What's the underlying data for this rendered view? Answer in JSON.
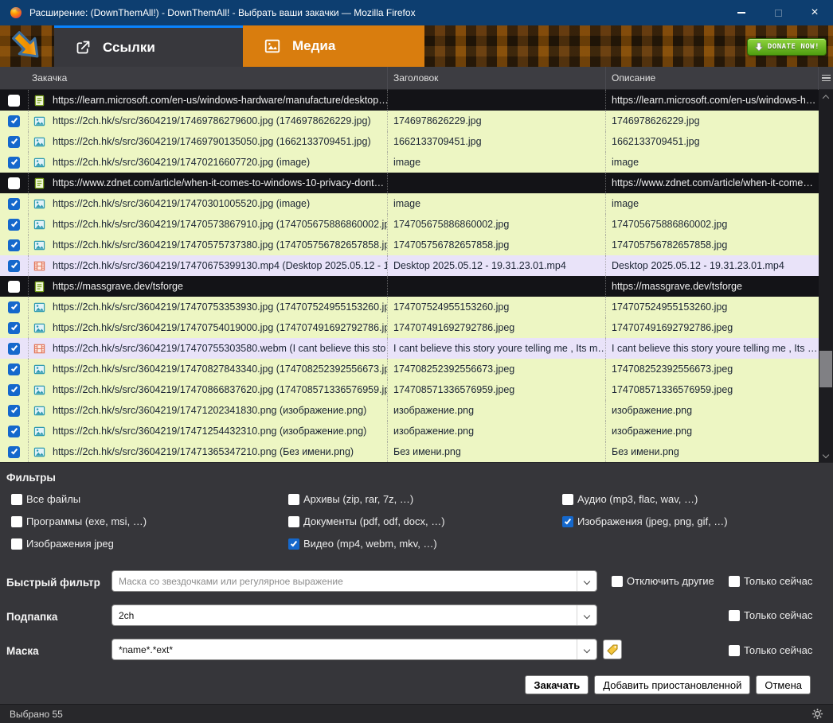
{
  "window": {
    "title": "Расширение: (DownThemAll!) - DownThemAll! - Выбрать ваши закачки — Mozilla Firefox"
  },
  "tabs": {
    "links": "Ссылки",
    "media": "Медиа"
  },
  "donate_label": "DONATE NOW!",
  "table": {
    "columns": [
      "Закачка",
      "Заголовок",
      "Описание"
    ],
    "rows": [
      {
        "checked": false,
        "variant": "dark",
        "icon": "doc",
        "url": "https://learn.microsoft.com/en-us/windows-hardware/manufacture/desktop…",
        "title": "",
        "desc": "https://learn.microsoft.com/en-us/windows-h…"
      },
      {
        "checked": true,
        "variant": "green",
        "icon": "image",
        "url": "https://2ch.hk/s/src/3604219/17469786279600.jpg (1746978626229.jpg)",
        "title": "1746978626229.jpg",
        "desc": "1746978626229.jpg"
      },
      {
        "checked": true,
        "variant": "green",
        "icon": "image",
        "url": "https://2ch.hk/s/src/3604219/17469790135050.jpg (1662133709451.jpg)",
        "title": "1662133709451.jpg",
        "desc": "1662133709451.jpg"
      },
      {
        "checked": true,
        "variant": "green",
        "icon": "image",
        "url": "https://2ch.hk/s/src/3604219/17470216607720.jpg (image)",
        "title": "image",
        "desc": "image"
      },
      {
        "checked": false,
        "variant": "dark",
        "icon": "doc",
        "url": "https://www.zdnet.com/article/when-it-comes-to-windows-10-privacy-dont…",
        "title": "",
        "desc": "https://www.zdnet.com/article/when-it-come…"
      },
      {
        "checked": true,
        "variant": "green",
        "icon": "image",
        "url": "https://2ch.hk/s/src/3604219/17470301005520.jpg (image)",
        "title": "image",
        "desc": "image"
      },
      {
        "checked": true,
        "variant": "green",
        "icon": "image",
        "url": "https://2ch.hk/s/src/3604219/17470573867910.jpg (174705675886860002.jp…",
        "title": "174705675886860002.jpg",
        "desc": "174705675886860002.jpg"
      },
      {
        "checked": true,
        "variant": "green",
        "icon": "image",
        "url": "https://2ch.hk/s/src/3604219/17470575737380.jpg (174705756782657858.jp…",
        "title": "174705756782657858.jpg",
        "desc": "174705756782657858.jpg"
      },
      {
        "checked": true,
        "variant": "lavender",
        "icon": "video",
        "url": "https://2ch.hk/s/src/3604219/17470675399130.mp4 (Desktop 2025.05.12 - 1…",
        "title": "Desktop 2025.05.12 - 19.31.23.01.mp4",
        "desc": "Desktop 2025.05.12 - 19.31.23.01.mp4"
      },
      {
        "checked": false,
        "variant": "dark",
        "icon": "doc",
        "url": "https://massgrave.dev/tsforge",
        "title": "",
        "desc": "https://massgrave.dev/tsforge"
      },
      {
        "checked": true,
        "variant": "green",
        "icon": "image",
        "url": "https://2ch.hk/s/src/3604219/17470753353930.jpg (174707524955153260.jp…",
        "title": "174707524955153260.jpg",
        "desc": "174707524955153260.jpg"
      },
      {
        "checked": true,
        "variant": "green",
        "icon": "image",
        "url": "https://2ch.hk/s/src/3604219/17470754019000.jpg (174707491692792786.jp…",
        "title": "174707491692792786.jpeg",
        "desc": "174707491692792786.jpeg"
      },
      {
        "checked": true,
        "variant": "lavender",
        "icon": "video",
        "url": "https://2ch.hk/s/src/3604219/17470755303580.webm (I cant believe this sto…",
        "title": "I cant believe this story youre telling me , Its m…",
        "desc": "I cant believe this story youre telling me , Its …"
      },
      {
        "checked": true,
        "variant": "green",
        "icon": "image",
        "url": "https://2ch.hk/s/src/3604219/17470827843340.jpg (174708252392556673.jp…",
        "title": "174708252392556673.jpeg",
        "desc": "174708252392556673.jpeg"
      },
      {
        "checked": true,
        "variant": "green",
        "icon": "image",
        "url": "https://2ch.hk/s/src/3604219/17470866837620.jpg (174708571336576959.jp…",
        "title": "174708571336576959.jpeg",
        "desc": "174708571336576959.jpeg"
      },
      {
        "checked": true,
        "variant": "green",
        "icon": "image",
        "url": "https://2ch.hk/s/src/3604219/17471202341830.png (изображение.png)",
        "title": "изображение.png",
        "desc": "изображение.png"
      },
      {
        "checked": true,
        "variant": "green",
        "icon": "image",
        "url": "https://2ch.hk/s/src/3604219/17471254432310.png (изображение.png)",
        "title": "изображение.png",
        "desc": "изображение.png"
      },
      {
        "checked": true,
        "variant": "green",
        "icon": "image",
        "url": "https://2ch.hk/s/src/3604219/17471365347210.png (Без имени.png)",
        "title": "Без имени.png",
        "desc": "Без имени.png"
      }
    ]
  },
  "filters": {
    "title": "Фильтры",
    "columns": [
      [
        {
          "label": "Все файлы",
          "checked": false
        },
        {
          "label": "Программы (exe, msi, …)",
          "checked": false
        },
        {
          "label": "Изображения jpeg",
          "checked": false
        }
      ],
      [
        {
          "label": "Архивы (zip, rar, 7z, …)",
          "checked": false
        },
        {
          "label": "Документы (pdf, odf, docx, …)",
          "checked": false
        },
        {
          "label": "Видео (mp4, webm, mkv, …)",
          "checked": true
        }
      ],
      [
        {
          "label": "Аудио (mp3, flac, wav, …)",
          "checked": false
        },
        {
          "label": "Изображения (jpeg, png, gif, …)",
          "checked": true
        }
      ]
    ]
  },
  "form": {
    "quick_filter": {
      "label": "Быстрый фильтр",
      "placeholder": "Маска со звездочками или регулярное выражение",
      "checkboxes": [
        {
          "label": "Отключить другие",
          "checked": false
        },
        {
          "label": "Только сейчас",
          "checked": false
        }
      ]
    },
    "subfolder": {
      "label": "Подпапка",
      "value": "2ch",
      "checkboxes": [
        {
          "label": "Только сейчас",
          "checked": false
        }
      ]
    },
    "mask": {
      "label": "Маска",
      "value": "*name*.*ext*",
      "checkboxes": [
        {
          "label": "Только сейчас",
          "checked": false
        }
      ]
    }
  },
  "actions": {
    "download": "Закачать",
    "add_paused": "Добавить приостановленной",
    "cancel": "Отмена"
  },
  "statusbar": {
    "text": "Выбрано 55"
  }
}
